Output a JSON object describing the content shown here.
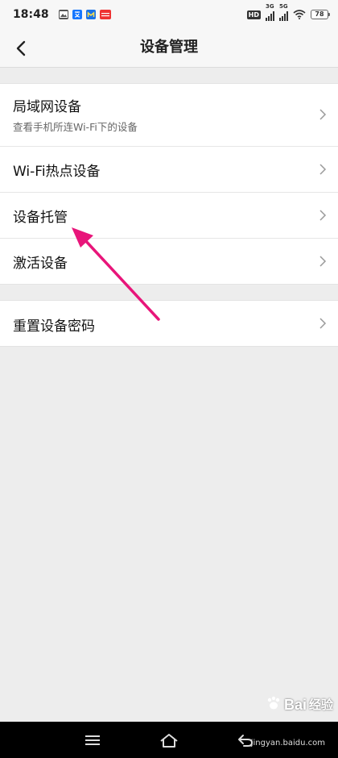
{
  "status_bar": {
    "time": "18:48",
    "hd_badge": "HD",
    "signal_1_label": "3G",
    "signal_2_label": "5G",
    "battery_level": "78",
    "notification_icons": [
      "gallery-icon",
      "translate-icon",
      "app-m-icon",
      "toutiao-icon"
    ]
  },
  "header": {
    "title": "设备管理"
  },
  "group1": {
    "items": [
      {
        "label": "局域网设备",
        "subtitle": "查看手机所连Wi-Fi下的设备"
      },
      {
        "label": "Wi-Fi热点设备"
      },
      {
        "label": "设备托管"
      },
      {
        "label": "激活设备"
      }
    ]
  },
  "group2": {
    "items": [
      {
        "label": "重置设备密码"
      }
    ]
  },
  "watermark": {
    "brand": "Bai",
    "brand_suffix": "经验",
    "site": "jingyan.baidu.com"
  },
  "colors": {
    "annotation_arrow": "#e8157a",
    "background": "#ededed",
    "card": "#ffffff"
  }
}
